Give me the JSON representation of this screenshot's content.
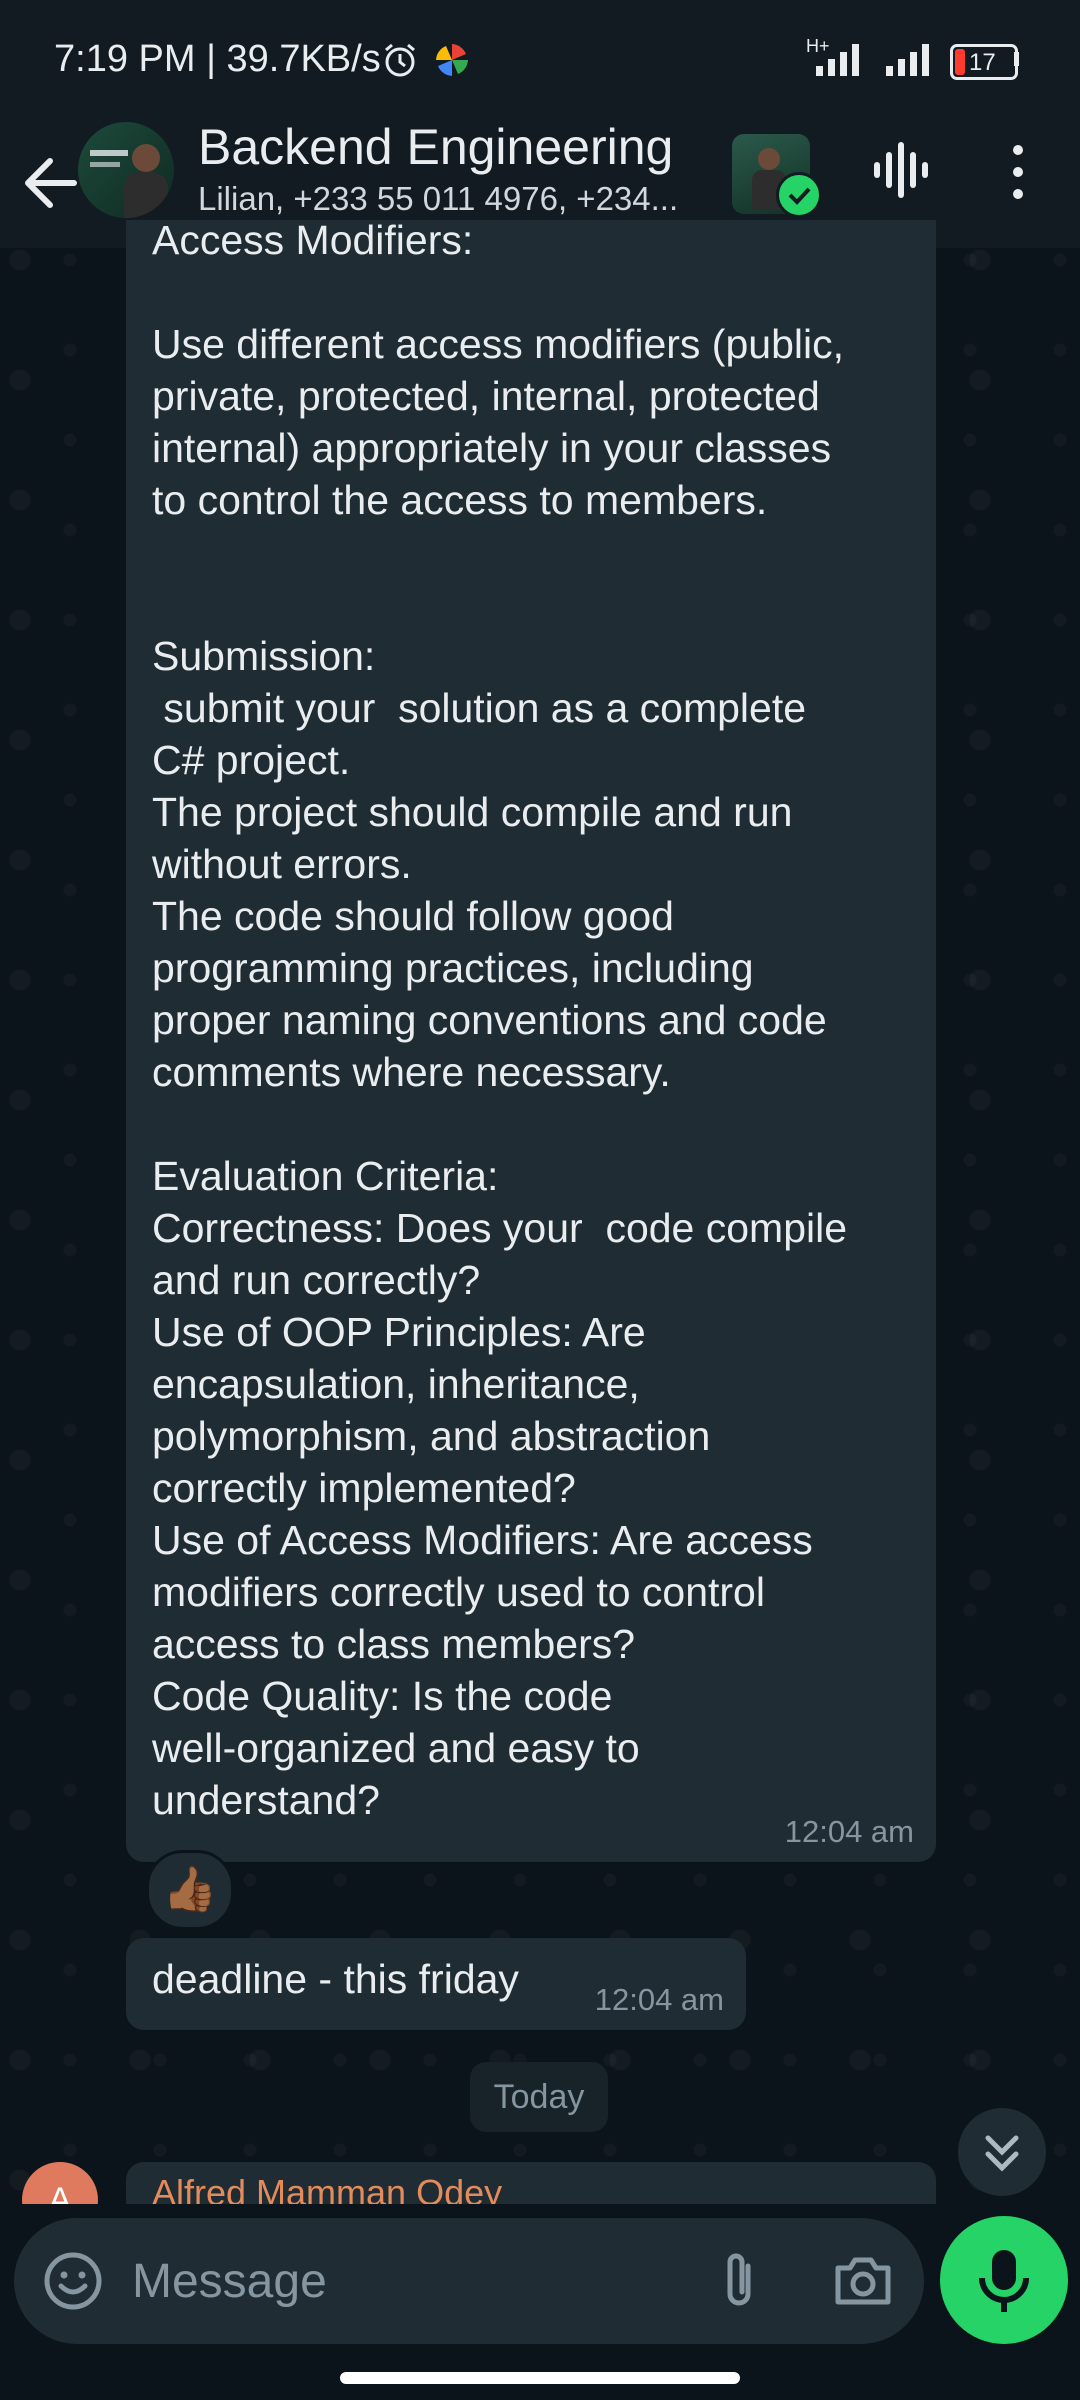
{
  "status_bar": {
    "time_speed": "7:19 PM | 39.7KB/s",
    "network": "H+",
    "battery": "17"
  },
  "header": {
    "title": "Backend Engineering",
    "subtitle": "Lilian, +233 55 011 4976, +234..."
  },
  "messages": [
    {
      "lines": [
        "Access Modifiers:",
        "",
        "Use different access modifiers (public,",
        "private, protected, internal, protected",
        "internal) appropriately in your classes",
        "to control the access to members.",
        "",
        "",
        "Submission:",
        " submit your  solution as a complete",
        "C# project.",
        "The project should compile and run",
        "without errors.",
        "The code should follow good",
        "programming practices, including",
        "proper naming conventions and code",
        "comments where necessary.",
        "",
        "Evaluation Criteria:",
        "Correctness: Does your  code compile",
        "and run correctly?",
        "Use of OOP Principles: Are",
        "encapsulation, inheritance,",
        "polymorphism, and abstraction",
        "correctly implemented?",
        "Use of Access Modifiers: Are access",
        "modifiers correctly used to control",
        "access to class members?",
        "Code Quality: Is the code",
        "well-organized and easy to",
        "understand?"
      ],
      "time": "12:04 am",
      "reaction": "👍🏾"
    },
    {
      "text": "deadline - this friday",
      "time": "12:04 am"
    }
  ],
  "date_divider": "Today",
  "next_message": {
    "avatar_initial": "A",
    "sender": "Alfred Mamman Odey"
  },
  "composer": {
    "placeholder": "Message"
  },
  "colors": {
    "accent": "#25d366",
    "bubble": "#202c33",
    "background": "#0b141a",
    "header": "#111b21"
  }
}
